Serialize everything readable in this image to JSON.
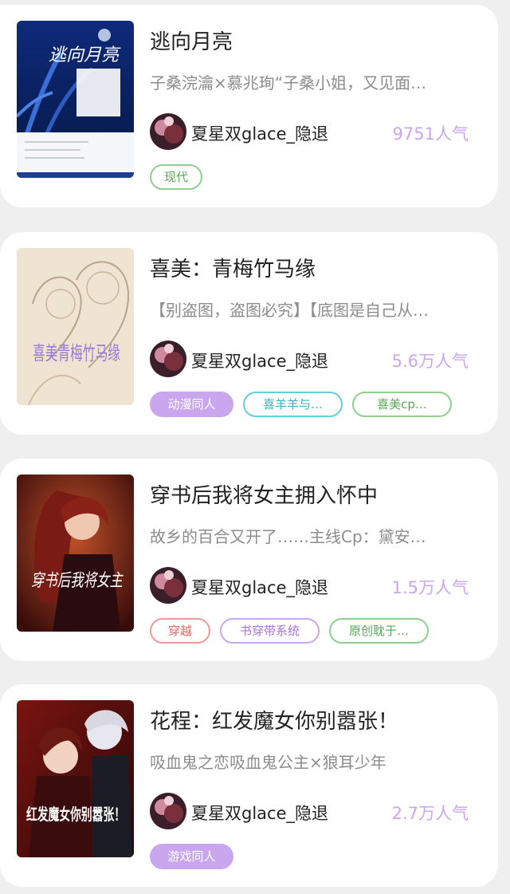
{
  "books": [
    {
      "title": "逃向月亮",
      "description": "子桑浣瀹×慕兆珣“子桑小姐，又见面…",
      "author": "夏星双glace_隐退",
      "popularity": "9751人气",
      "cover_text": "逃向月亮",
      "tags": [
        {
          "label": "现代"
        }
      ]
    },
    {
      "title": "喜美：青梅竹马缘",
      "description": "【别盗图，盗图必究】【底图是自己从…",
      "author": "夏星双glace_隐退",
      "popularity": "5.6万人气",
      "cover_text": "喜美青梅竹马缘",
      "tags": [
        {
          "label": "动漫同人"
        },
        {
          "label": "喜羊羊与…"
        },
        {
          "label": "喜美cp…"
        }
      ]
    },
    {
      "title": "穿书后我将女主拥入怀中",
      "description": "故乡的百合又开了……主线Cp：黛安…",
      "author": "夏星双glace_隐退",
      "popularity": "1.5万人气",
      "cover_text": "穿书后我将女主",
      "tags": [
        {
          "label": "穿越"
        },
        {
          "label": "书穿带系统"
        },
        {
          "label": "原创耽于…"
        }
      ]
    },
    {
      "title": "花程：红发魔女你别嚣张！",
      "description": "吸血鬼之恋吸血鬼公主×狼耳少年",
      "author": "夏星双glace_隐退",
      "popularity": "2.7万人气",
      "cover_text": "红发魔女你别嚣张！",
      "tags": [
        {
          "label": "游戏同人"
        }
      ]
    }
  ],
  "colors": {
    "popularity": "#c9a6ee",
    "tag_green": "#8fcf8f",
    "tag_purple": "#c9a6ee",
    "tag_teal": "#64cfd6",
    "tag_red": "#ee9a9a"
  }
}
